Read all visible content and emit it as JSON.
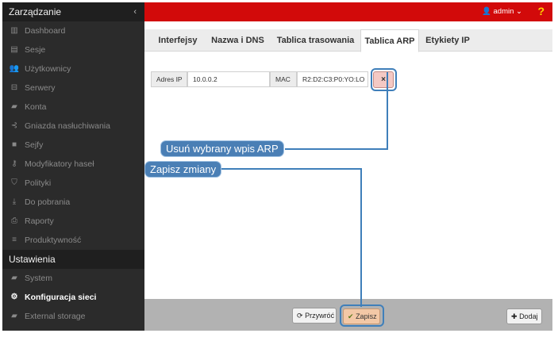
{
  "sidebar": {
    "header": "Zarządzanie",
    "collapse_icon": "chevron-left",
    "items": [
      {
        "label": "Dashboard",
        "icon": "dashboard-icon",
        "glyph": "▥"
      },
      {
        "label": "Sesje",
        "icon": "sessions-icon",
        "glyph": "▤"
      },
      {
        "label": "Użytkownicy",
        "icon": "users-icon",
        "glyph": "👥"
      },
      {
        "label": "Serwery",
        "icon": "servers-icon",
        "glyph": "⊟"
      },
      {
        "label": "Konta",
        "icon": "accounts-icon",
        "glyph": "▰"
      },
      {
        "label": "Gniazda nasłuchiwania",
        "icon": "listeners-icon",
        "glyph": "⊰"
      },
      {
        "label": "Sejfy",
        "icon": "safes-icon",
        "glyph": "■"
      },
      {
        "label": "Modyfikatory haseł",
        "icon": "password-modifiers-icon",
        "glyph": "⚷"
      },
      {
        "label": "Polityki",
        "icon": "policies-icon",
        "glyph": "⛉"
      },
      {
        "label": "Do pobrania",
        "icon": "download-icon",
        "glyph": "⤓"
      },
      {
        "label": "Raporty",
        "icon": "reports-icon",
        "glyph": "⎙"
      },
      {
        "label": "Produktywność",
        "icon": "productivity-icon",
        "glyph": "≡"
      }
    ],
    "section": "Ustawienia",
    "settings_items": [
      {
        "label": "System",
        "icon": "system-folder-icon",
        "glyph": "▰",
        "active": false
      },
      {
        "label": "Konfiguracja sieci",
        "icon": "network-config-icon",
        "glyph": "⚙",
        "active": true
      },
      {
        "label": "External storage",
        "icon": "external-storage-icon",
        "glyph": "▰",
        "active": false
      }
    ]
  },
  "topbar": {
    "user_label": "admin",
    "help_label": "?",
    "colors": {
      "bar": "#d20a0a",
      "help": "#ffd400"
    }
  },
  "tabs": [
    {
      "label": "Interfejsy",
      "active": false
    },
    {
      "label": "Nazwa i DNS",
      "active": false
    },
    {
      "label": "Tablica trasowania",
      "active": false
    },
    {
      "label": "Tablica ARP",
      "active": true
    },
    {
      "label": "Etykiety IP",
      "active": false
    }
  ],
  "arp_entry": {
    "ip_label": "Adres IP",
    "ip_value": "10.0.0.2",
    "mac_label": "MAC",
    "mac_value": "R2:D2:C3:P0:YO:LO",
    "delete_glyph": "×"
  },
  "callouts": {
    "delete": "Usuń wybrany wpis ARP",
    "save": "Zapisz zmiany"
  },
  "footer": {
    "revert_label": "Przywróć",
    "save_label": "Zapisz",
    "add_label": "Dodaj"
  }
}
